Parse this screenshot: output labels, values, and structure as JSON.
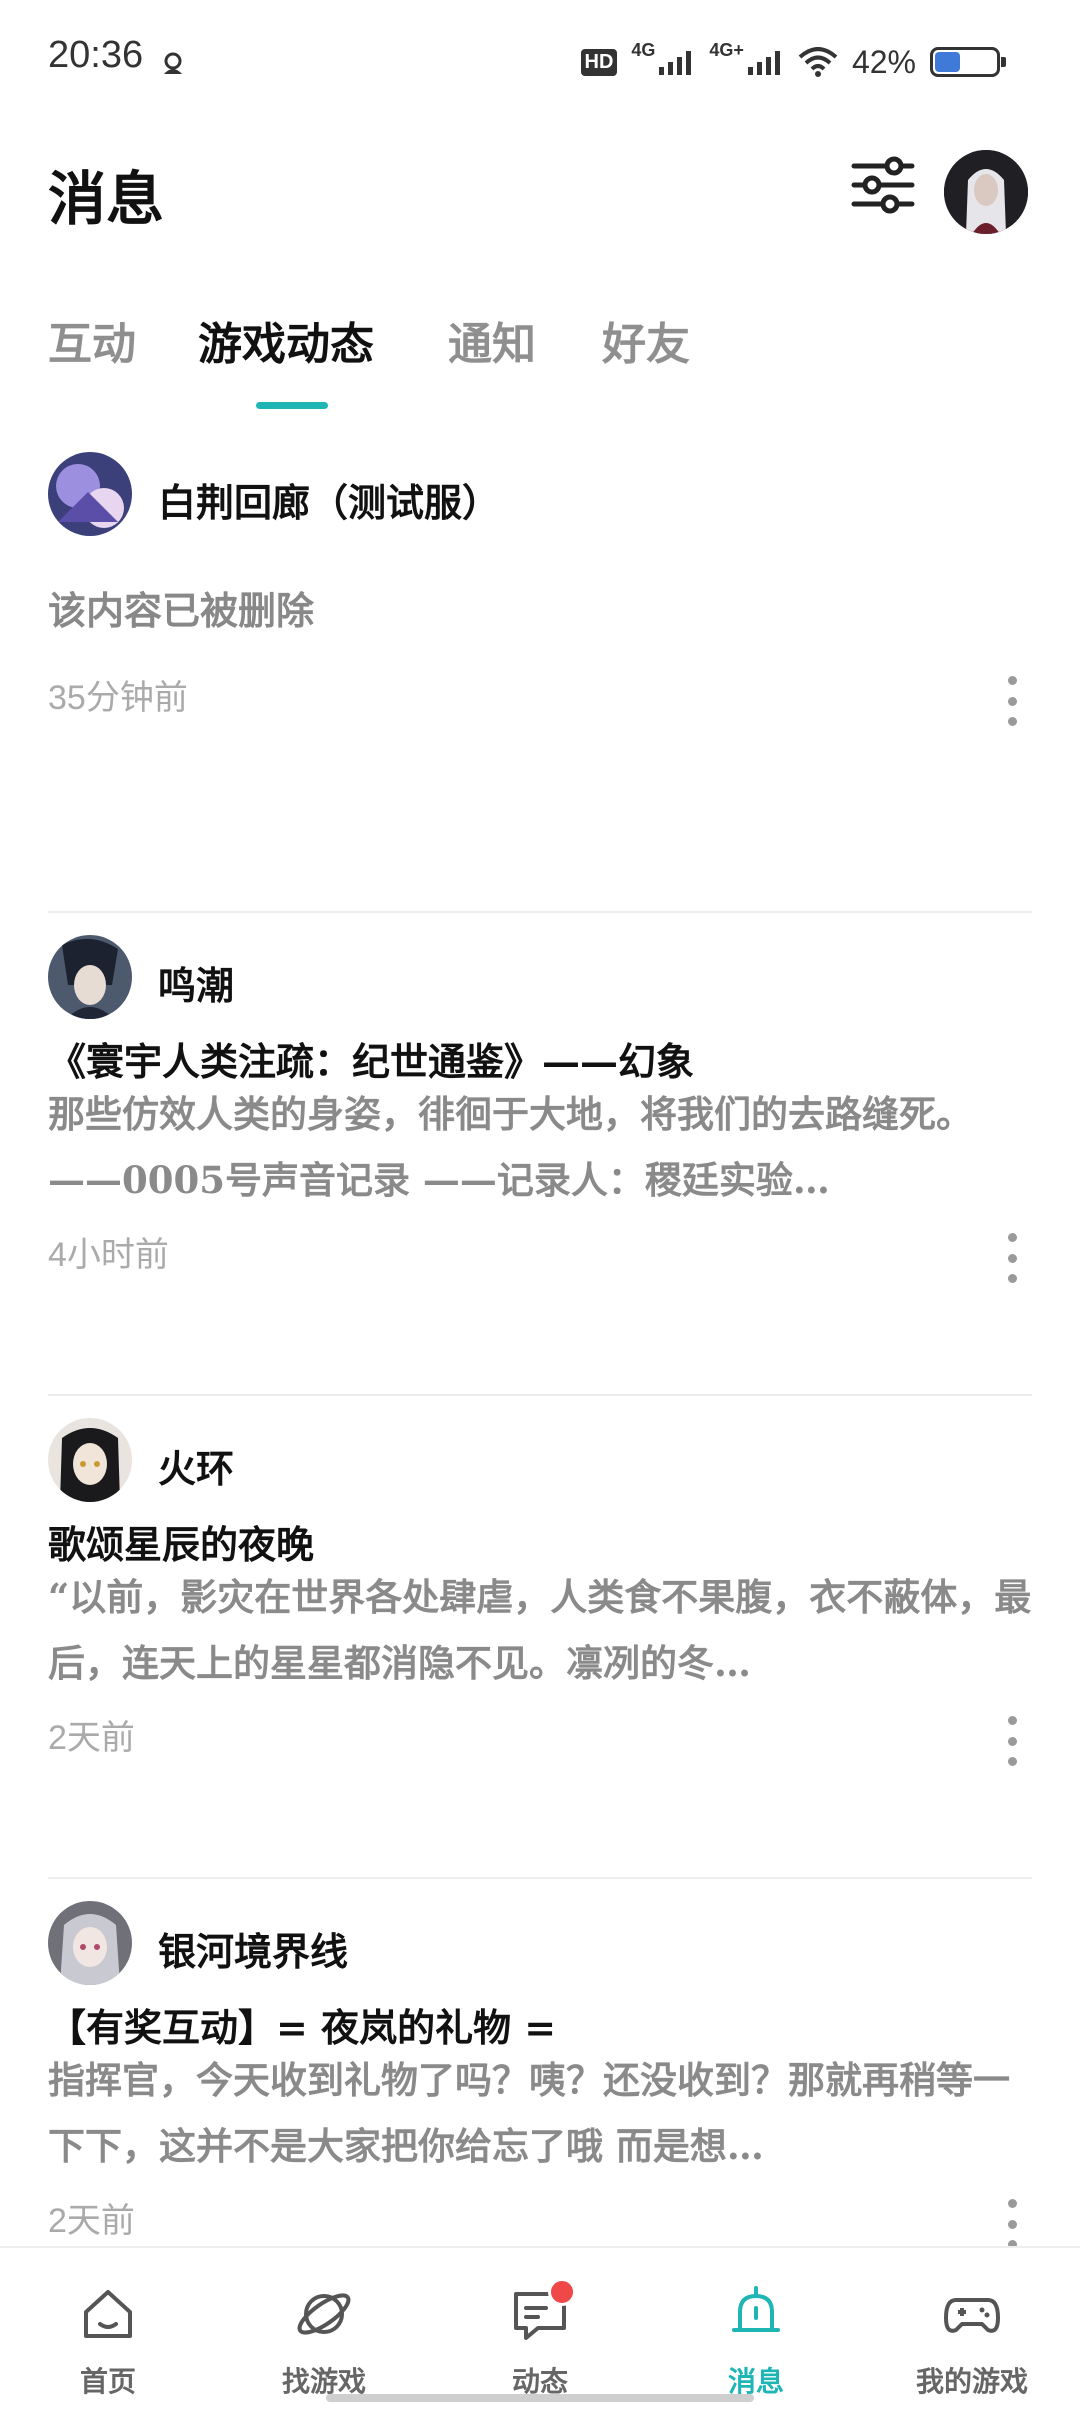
{
  "status_bar": {
    "time": "20:36",
    "network": [
      "HD",
      "4G",
      "4G+"
    ],
    "battery_percent_text": "42%",
    "battery_level": 0.42
  },
  "header": {
    "title": "消息",
    "filter_icon": "sliders-icon",
    "avatar_icon": "user-avatar"
  },
  "tabs": [
    {
      "label": "互动",
      "active": false
    },
    {
      "label": "游戏动态",
      "active": true
    },
    {
      "label": "通知",
      "active": false
    },
    {
      "label": "好友",
      "active": false
    }
  ],
  "accent_color": "#20b5b5",
  "feed": [
    {
      "author": "白荆回廊（测试服）",
      "deleted_text": "该内容已被删除",
      "title": "",
      "excerpt": "",
      "time": "35分钟前"
    },
    {
      "author": "鸣潮",
      "deleted_text": "",
      "title": "《寰宇人类注疏：纪世通鉴》——幻象",
      "excerpt": "那些仿效人类的身姿，徘徊于大地，将我们的去路缝死。——0005号声音记录 ——记录人：稷廷实验…",
      "time": "4小时前"
    },
    {
      "author": "火环",
      "deleted_text": "",
      "title": "歌颂星辰的夜晚",
      "excerpt": "“以前，影灾在世界各处肆虐，人类食不果腹，衣不蔽体，最后，连天上的星星都消隐不见。凛冽的冬…",
      "time": "2天前"
    },
    {
      "author": "银河境界线",
      "deleted_text": "",
      "title": "【有奖互动】= 夜岚的礼物 =",
      "excerpt": "指挥官，今天收到礼物了吗？咦？还没收到？那就再稍等一下下，这并不是大家把你给忘了哦 而是想…",
      "time": "2天前"
    }
  ],
  "bottom_nav": [
    {
      "label": "首页",
      "icon": "home-icon",
      "active": false
    },
    {
      "label": "找游戏",
      "icon": "planet-icon",
      "active": false
    },
    {
      "label": "动态",
      "icon": "chat-icon",
      "active": false,
      "badge": true
    },
    {
      "label": "消息",
      "icon": "bell-icon",
      "active": true
    },
    {
      "label": "我的游戏",
      "icon": "gamepad-icon",
      "active": false
    }
  ]
}
